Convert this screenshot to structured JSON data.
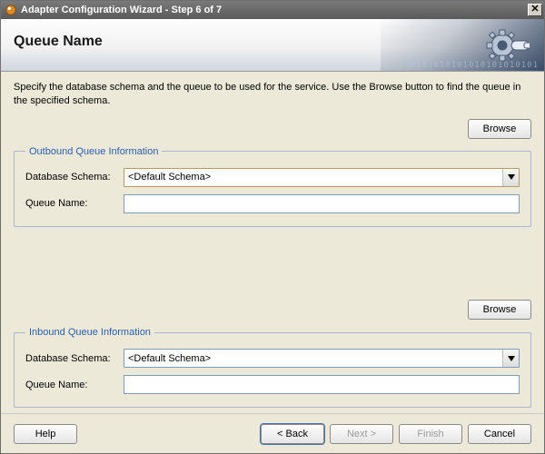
{
  "window": {
    "title": "Adapter Configuration Wizard - Step 6 of 7"
  },
  "banner": {
    "heading": "Queue Name",
    "binary": "0101010101010101010101"
  },
  "instruction": "Specify the database schema and the queue to be used for the service. Use the Browse button to find the queue in the specified schema.",
  "outbound": {
    "browse_label": "Browse",
    "legend": "Outbound Queue Information",
    "schema_label": "Database Schema:",
    "schema_value": "<Default Schema>",
    "queue_label": "Queue Name:",
    "queue_value": ""
  },
  "inbound": {
    "browse_label": "Browse",
    "legend": "Inbound Queue Information",
    "schema_label": "Database Schema:",
    "schema_value": "<Default Schema>",
    "queue_label": "Queue Name:",
    "queue_value": ""
  },
  "buttons": {
    "help": "Help",
    "back": "< Back",
    "next": "Next >",
    "finish": "Finish",
    "cancel": "Cancel"
  }
}
